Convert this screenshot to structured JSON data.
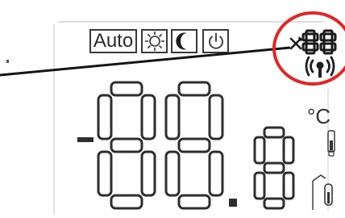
{
  "mode_bar": {
    "auto_label": "Auto",
    "items": [
      {
        "name": "sun-icon"
      },
      {
        "name": "moon-icon"
      },
      {
        "name": "power-icon"
      }
    ]
  },
  "status": {
    "setting_value": "88",
    "wrench_icon": "wrench-icon",
    "signal_icon": "wireless-signal-icon"
  },
  "main_display": {
    "digits": "88.8",
    "unit": "°C",
    "sign": "-"
  },
  "indicators": [
    {
      "name": "thermometer-icon"
    },
    {
      "name": "room-thermometer-icon"
    }
  ],
  "colors": {
    "segment": "#2e2e2e",
    "callout": "#e02626",
    "background": "#ffffff"
  }
}
